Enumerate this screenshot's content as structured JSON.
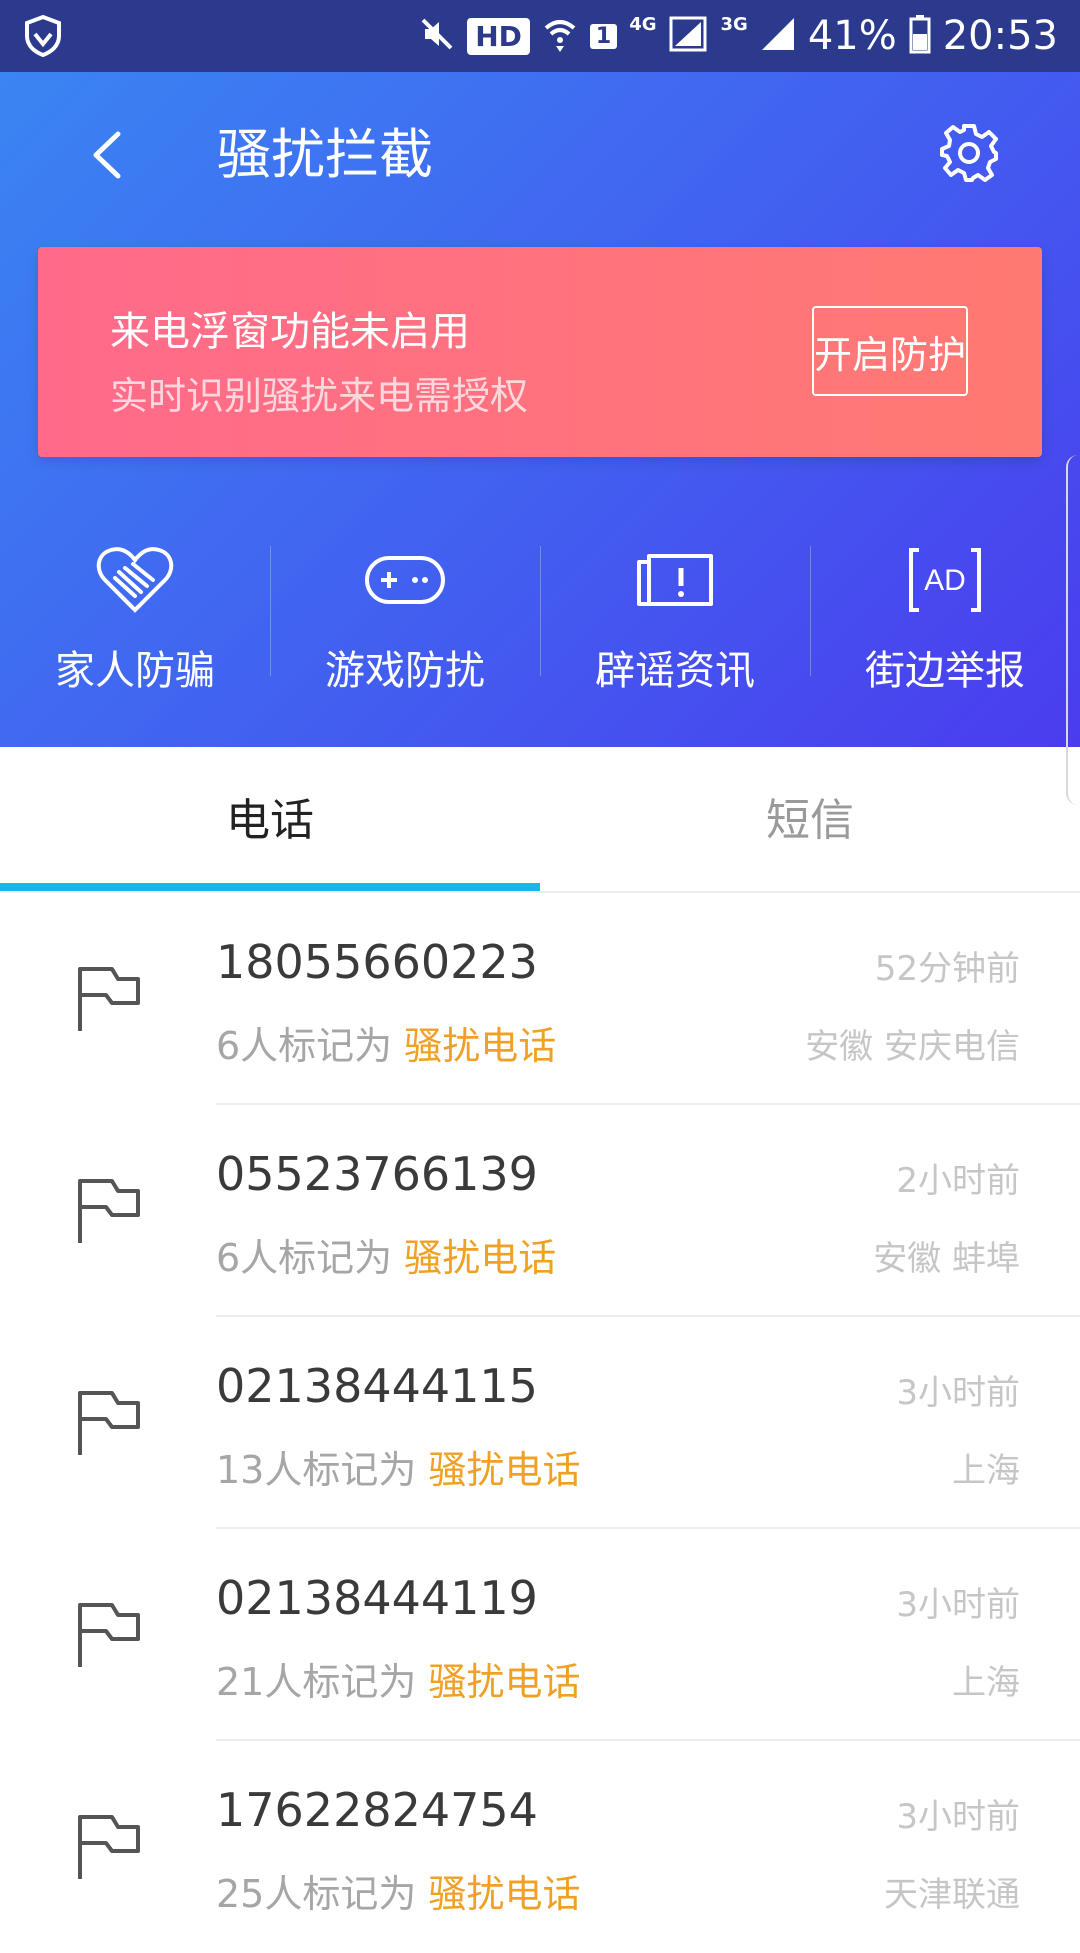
{
  "status_bar": {
    "hd": "HD",
    "sim": "1",
    "net_4g": "4G",
    "net_3g": "3G",
    "battery": "41%",
    "time": "20:53"
  },
  "header": {
    "title": "骚扰拦截"
  },
  "banner": {
    "title": "来电浮窗功能未启用",
    "subtitle": "实时识别骚扰来电需授权",
    "button": "开启防护"
  },
  "quick_actions": [
    {
      "label": "家人防骗",
      "icon": "heart-hand-icon"
    },
    {
      "label": "游戏防扰",
      "icon": "gamepad-icon"
    },
    {
      "label": "辟谣资讯",
      "icon": "notice-icon"
    },
    {
      "label": "街边举报",
      "icon": "ad-icon"
    }
  ],
  "tabs": [
    {
      "label": "电话",
      "active": true
    },
    {
      "label": "短信",
      "active": false
    }
  ],
  "calls": [
    {
      "number": "18055660223",
      "count_text": "6人标记为",
      "tag": "骚扰电话",
      "time": "52分钟前",
      "location": "安徽 安庆电信"
    },
    {
      "number": "05523766139",
      "count_text": "6人标记为",
      "tag": "骚扰电话",
      "time": "2小时前",
      "location": "安徽 蚌埠"
    },
    {
      "number": "02138444115",
      "count_text": "13人标记为",
      "tag": "骚扰电话",
      "time": "3小时前",
      "location": "上海"
    },
    {
      "number": "02138444119",
      "count_text": "21人标记为",
      "tag": "骚扰电话",
      "time": "3小时前",
      "location": "上海"
    },
    {
      "number": "17622824754",
      "count_text": "25人标记为",
      "tag": "骚扰电话",
      "time": "3小时前",
      "location": "天津联通"
    }
  ],
  "colors": {
    "accent": "#1ab6e8",
    "tag": "#f0a024",
    "banner": "#ff6f80"
  }
}
